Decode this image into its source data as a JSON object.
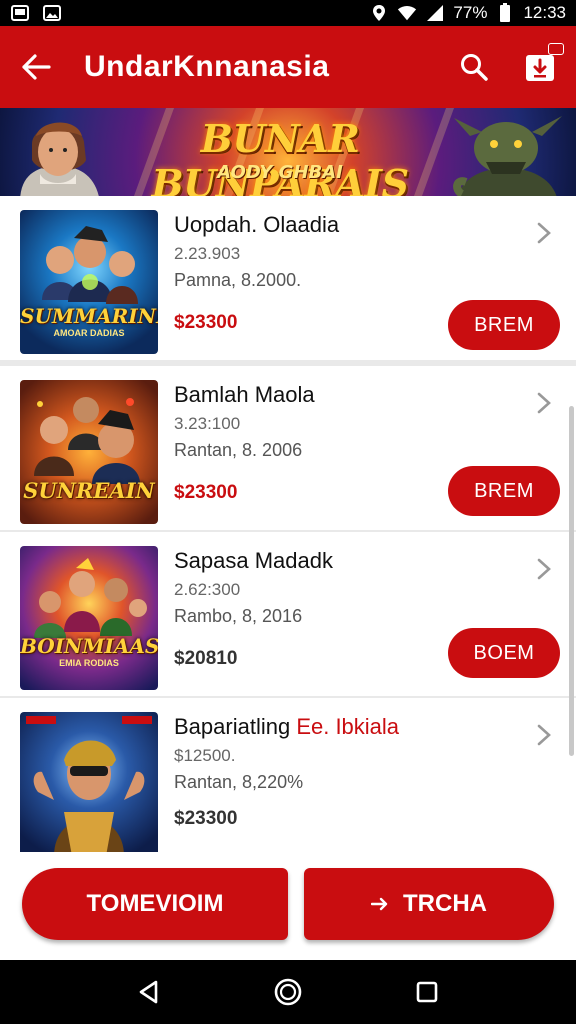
{
  "status_bar": {
    "battery": "77%",
    "time": "12:33",
    "icons": [
      "gallery-icon",
      "image-icon",
      "location-icon",
      "wifi-icon",
      "signal-icon",
      "battery-icon"
    ]
  },
  "app_bar": {
    "title": "UndarKnnanasia",
    "icons": [
      "back-arrow-icon",
      "search-icon",
      "download-icon"
    ]
  },
  "banner": {
    "title": "BUNAR BUNPARAIS",
    "subtitle": "AODY GHBAI"
  },
  "items": [
    {
      "name": "Uopdah. Olaadia",
      "name_highlight": "",
      "meta1": "2.23.903",
      "meta2": "Pamna, 8.2000.",
      "price": "$23300",
      "price_red": true,
      "button": "BREM",
      "thumb_title": "SUMMARINI",
      "thumb_sub": "AMOAR DADIAS"
    },
    {
      "name": "Bamlah Maola",
      "name_highlight": "",
      "meta1": "3.23:100",
      "meta2": "Rantan, 8. 2006",
      "price": "$23300",
      "price_red": true,
      "button": "BREM",
      "thumb_title": "SUNREAIN",
      "thumb_sub": ""
    },
    {
      "name": "Sapasa Madadk",
      "name_highlight": "",
      "meta1": "2.62:300",
      "meta2": "Rambo, 8, 2016",
      "price": "$20810",
      "price_red": false,
      "button": "BOEM",
      "thumb_title": "BOINMIAAS",
      "thumb_sub": "EMIA RODIAS"
    },
    {
      "name": "Bapariatling ",
      "name_highlight": "Ee. Ibkiala",
      "meta1": "$12500.",
      "meta2": "Rantan, 8,220%",
      "price": "$23300",
      "price_red": false,
      "button": "",
      "thumb_title": "",
      "thumb_sub": ""
    }
  ],
  "bottom_actions": {
    "left_label": "TOMEVIOIM",
    "right_label": "TRCHA",
    "right_icon": "arrow-right-icon"
  },
  "nav_bar": {
    "icons": [
      "back-triangle-icon",
      "home-circle-icon",
      "recents-square-icon"
    ]
  },
  "colors": {
    "primary_red": "#c90d10",
    "status_bar": "#000000",
    "background": "#e9e9e9"
  }
}
